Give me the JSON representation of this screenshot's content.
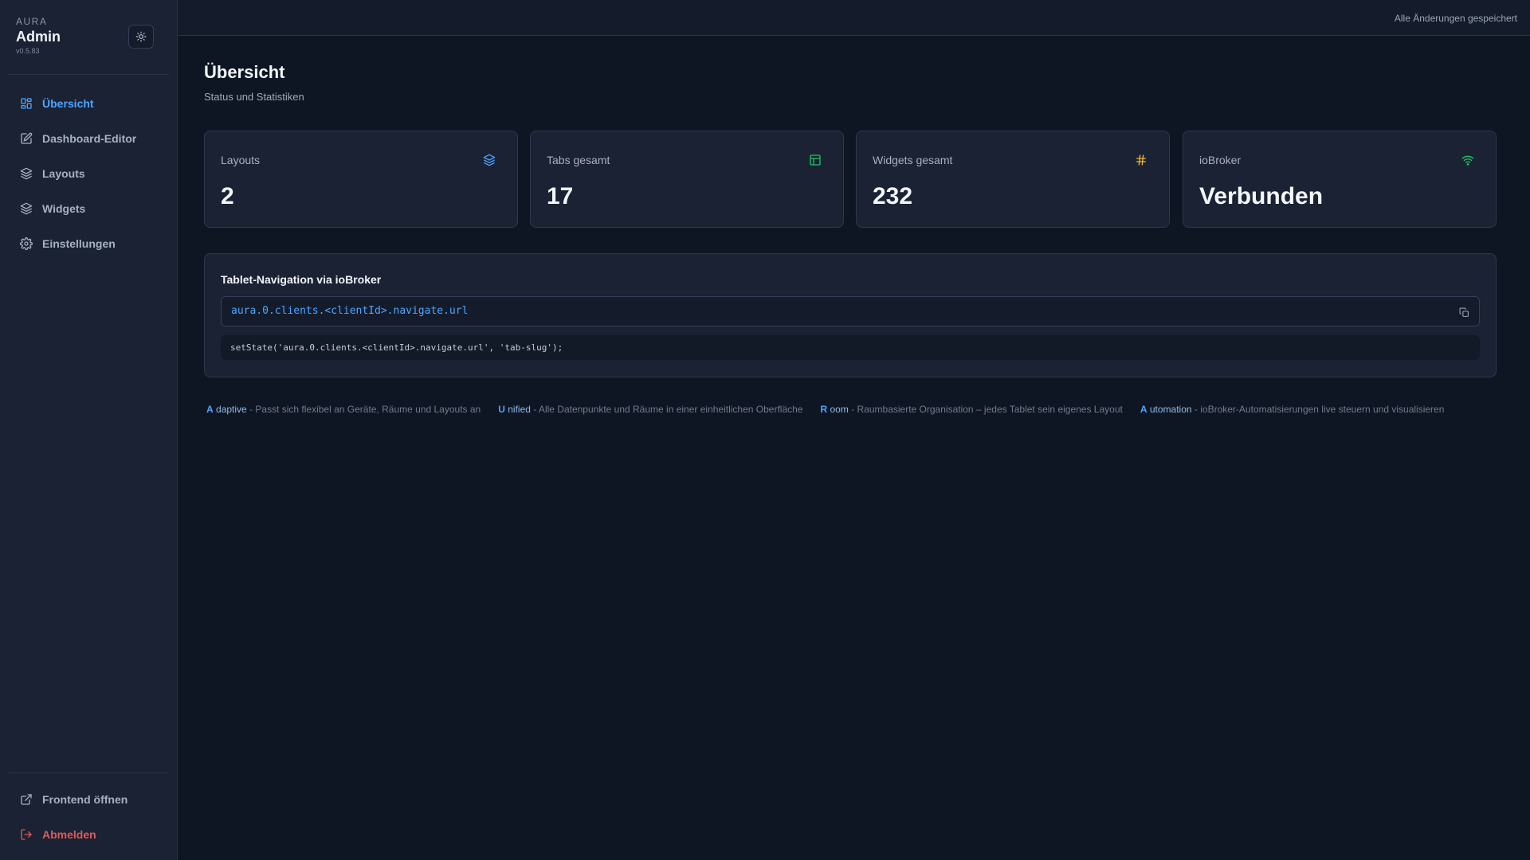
{
  "brand": {
    "kicker": "AURA",
    "title": "Admin",
    "version": "v0.5.83"
  },
  "sidebar": {
    "items": [
      {
        "label": "Übersicht",
        "icon": "grid-icon",
        "active": true
      },
      {
        "label": "Dashboard-Editor",
        "icon": "edit-icon",
        "active": false
      },
      {
        "label": "Layouts",
        "icon": "layers-icon",
        "active": false
      },
      {
        "label": "Widgets",
        "icon": "layers-icon",
        "active": false
      },
      {
        "label": "Einstellungen",
        "icon": "gear-icon",
        "active": false
      }
    ],
    "bottom": [
      {
        "label": "Frontend öffnen",
        "icon": "external-link-icon"
      },
      {
        "label": "Abmelden",
        "icon": "logout-icon"
      }
    ]
  },
  "topbar": {
    "status": "Alle Änderungen gespeichert"
  },
  "page": {
    "title": "Übersicht",
    "subtitle": "Status und Statistiken"
  },
  "stats": [
    {
      "label": "Layouts",
      "value": "2",
      "icon": "layers-icon",
      "icon_color": "#4ea5ff"
    },
    {
      "label": "Tabs gesamt",
      "value": "17",
      "icon": "table-icon",
      "icon_color": "#22c55e"
    },
    {
      "label": "Widgets gesamt",
      "value": "232",
      "icon": "hash-icon",
      "icon_color": "#f5b43a"
    },
    {
      "label": "ioBroker",
      "value": "Verbunden",
      "icon": "wifi-icon",
      "icon_color": "#22c55e"
    }
  ],
  "navigation_panel": {
    "title": "Tablet-Navigation via ioBroker",
    "state_path": "aura.0.clients.<clientId>.navigate.url",
    "example": "setState('aura.0.clients.<clientId>.navigate.url', 'tab-slug');"
  },
  "tagline": [
    {
      "letter": "A",
      "word": "daptive",
      "text": "- Passt sich flexibel an Geräte, Räume und Layouts an"
    },
    {
      "letter": "U",
      "word": "nified",
      "text": "- Alle Datenpunkte und Räume in einer einheitlichen Oberfläche"
    },
    {
      "letter": "R",
      "word": "oom",
      "text": "- Raumbasierte Organisation – jedes Tablet sein eigenes Layout"
    },
    {
      "letter": "A",
      "word": "utomation",
      "text": "- ioBroker-Automatisierungen live steuern und visualisieren"
    }
  ],
  "colors": {
    "accent": "#4ea5ff",
    "success": "#22c55e",
    "warning": "#f5b43a",
    "danger": "#e05a5a"
  }
}
